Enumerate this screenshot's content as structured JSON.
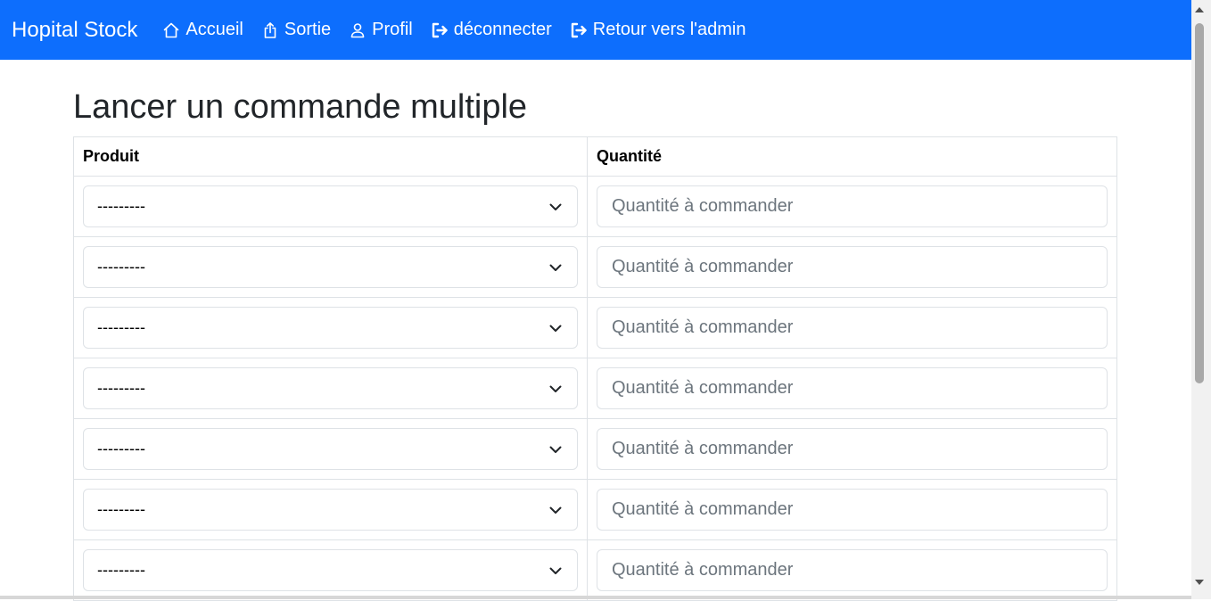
{
  "navbar": {
    "brand": "Hopital Stock",
    "items": [
      {
        "label": "Accueil",
        "icon": "house-icon"
      },
      {
        "label": "Sortie",
        "icon": "box-arrow-up-icon"
      },
      {
        "label": "Profil",
        "icon": "person-icon"
      },
      {
        "label": "déconnecter",
        "icon": "box-arrow-right-icon"
      },
      {
        "label": "Retour vers l'admin",
        "icon": "box-arrow-right-icon"
      }
    ],
    "color": "#0d6efd"
  },
  "page": {
    "title": "Lancer un commande multiple"
  },
  "table": {
    "headers": [
      "Produit",
      "Quantité"
    ],
    "rows": [
      {
        "product": "---------",
        "quantity_placeholder": "Quantité à commander",
        "quantity_value": ""
      },
      {
        "product": "---------",
        "quantity_placeholder": "Quantité à commander",
        "quantity_value": ""
      },
      {
        "product": "---------",
        "quantity_placeholder": "Quantité à commander",
        "quantity_value": ""
      },
      {
        "product": "---------",
        "quantity_placeholder": "Quantité à commander",
        "quantity_value": ""
      },
      {
        "product": "---------",
        "quantity_placeholder": "Quantité à commander",
        "quantity_value": ""
      },
      {
        "product": "---------",
        "quantity_placeholder": "Quantité à commander",
        "quantity_value": ""
      },
      {
        "product": "---------",
        "quantity_placeholder": "Quantité à commander",
        "quantity_value": ""
      }
    ]
  }
}
